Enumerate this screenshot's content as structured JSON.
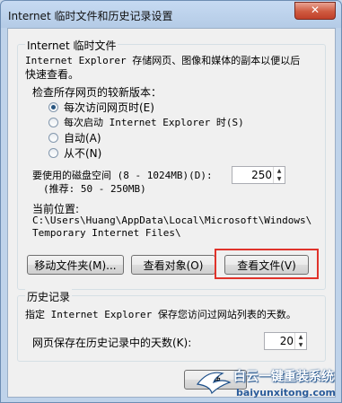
{
  "window": {
    "title": "Internet 临时文件和历史记录设置",
    "close_icon": "close-icon"
  },
  "temp_files": {
    "group_title": "Internet 临时文件",
    "description_line1": "Internet Explorer 存储网页、图像和媒体的副本以便以后",
    "description_line2": "快速查看。",
    "check_label": "检查所存网页的较新版本：",
    "options": [
      {
        "label": "每次访问网页时(E)",
        "selected": true
      },
      {
        "label": "每次启动 Internet Explorer 时(S)",
        "selected": false
      },
      {
        "label": "自动(A)",
        "selected": false
      },
      {
        "label": "从不(N)",
        "selected": false
      }
    ],
    "disk_space_label": "要使用的磁盘空间 (8 - 1024MB)(D):",
    "disk_space_recommend": "(推荐: 50 - 250MB)",
    "disk_space_value": "250",
    "location_label": "当前位置:",
    "location_line1": "C:\\Users\\Huang\\AppData\\Local\\Microsoft\\Windows\\",
    "location_line2": "Temporary Internet Files\\",
    "buttons": {
      "move_folder": "移动文件夹(M)...",
      "view_objects": "查看对象(O)",
      "view_files": "查看文件(V)"
    }
  },
  "history": {
    "group_title": "历史记录",
    "description": "指定 Internet Explorer 保存您访问过网站列表的天数。",
    "days_label": "网页保存在历史记录中的天数(K):",
    "days_value": "20"
  },
  "footer": {
    "ok_partial": "确"
  },
  "watermark": {
    "title": "白云一键重装系统",
    "url": "baiyunxitong.com"
  },
  "colors": {
    "highlight": "#e0332b",
    "accent": "#27547f"
  }
}
